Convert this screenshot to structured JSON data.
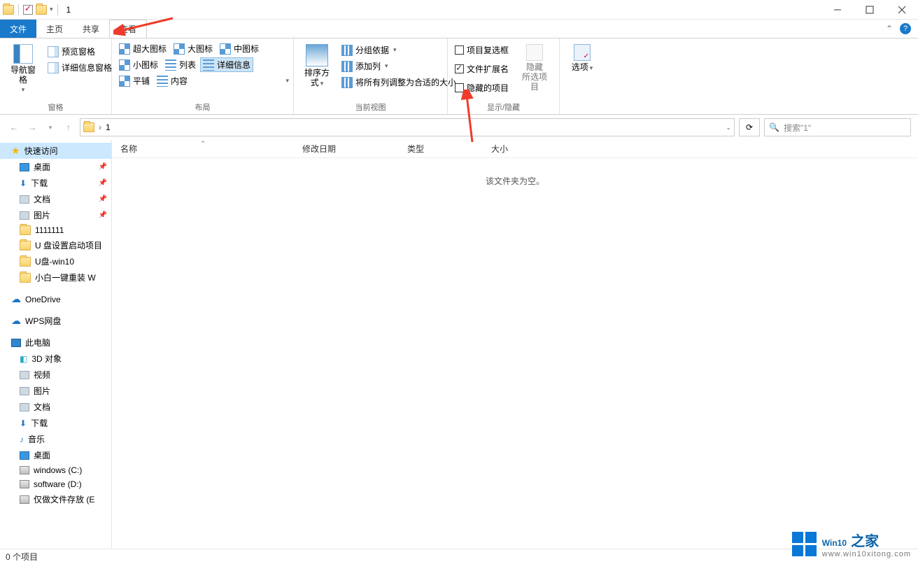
{
  "window": {
    "title": "1"
  },
  "tabs": {
    "file": "文件",
    "home": "主页",
    "share": "共享",
    "view": "查看"
  },
  "ribbon": {
    "panes": {
      "label": "窗格",
      "nav": "导航窗格",
      "preview": "预览窗格",
      "details": "详细信息窗格"
    },
    "layout": {
      "label": "布局",
      "extra_large": "超大图标",
      "large": "大图标",
      "medium": "中图标",
      "small": "小图标",
      "list": "列表",
      "details": "详细信息",
      "tiles": "平铺",
      "content": "内容"
    },
    "current_view": {
      "label": "当前视图",
      "sort": "排序方式",
      "group": "分组依据",
      "add_col": "添加列",
      "fit": "将所有列调整为合适的大小"
    },
    "show_hide": {
      "label": "显示/隐藏",
      "checkboxes": "项目复选框",
      "extensions": "文件扩展名",
      "hidden": "隐藏的项目",
      "hide_btn": "隐藏",
      "hide_sub": "所选项目"
    },
    "options": {
      "label": "选项"
    }
  },
  "address": {
    "current": "1"
  },
  "search": {
    "placeholder": "搜索\"1\""
  },
  "columns": {
    "name": "名称",
    "date": "修改日期",
    "type": "类型",
    "size": "大小"
  },
  "empty": "该文件夹为空。",
  "sidebar": {
    "quick": "快速访问",
    "desktop": "桌面",
    "downloads": "下载",
    "documents": "文档",
    "pictures": "图片",
    "f1": "1111111",
    "f2": "U 盘设置启动项目",
    "f3": "U盘-win10",
    "f4": "小白一键重装 W",
    "onedrive": "OneDrive",
    "wps": "WPS网盘",
    "thispc": "此电脑",
    "obj3d": "3D 对象",
    "videos": "视频",
    "pics2": "图片",
    "docs2": "文档",
    "dl2": "下载",
    "music": "音乐",
    "desk2": "桌面",
    "drv_c": "windows (C:)",
    "drv_d": "software (D:)",
    "drv_e": "仅做文件存放 (E"
  },
  "status": {
    "count": "0 个项目"
  },
  "watermark": {
    "brand": "Win10",
    "zh": "之家",
    "url": "www.win10xitong.com"
  }
}
